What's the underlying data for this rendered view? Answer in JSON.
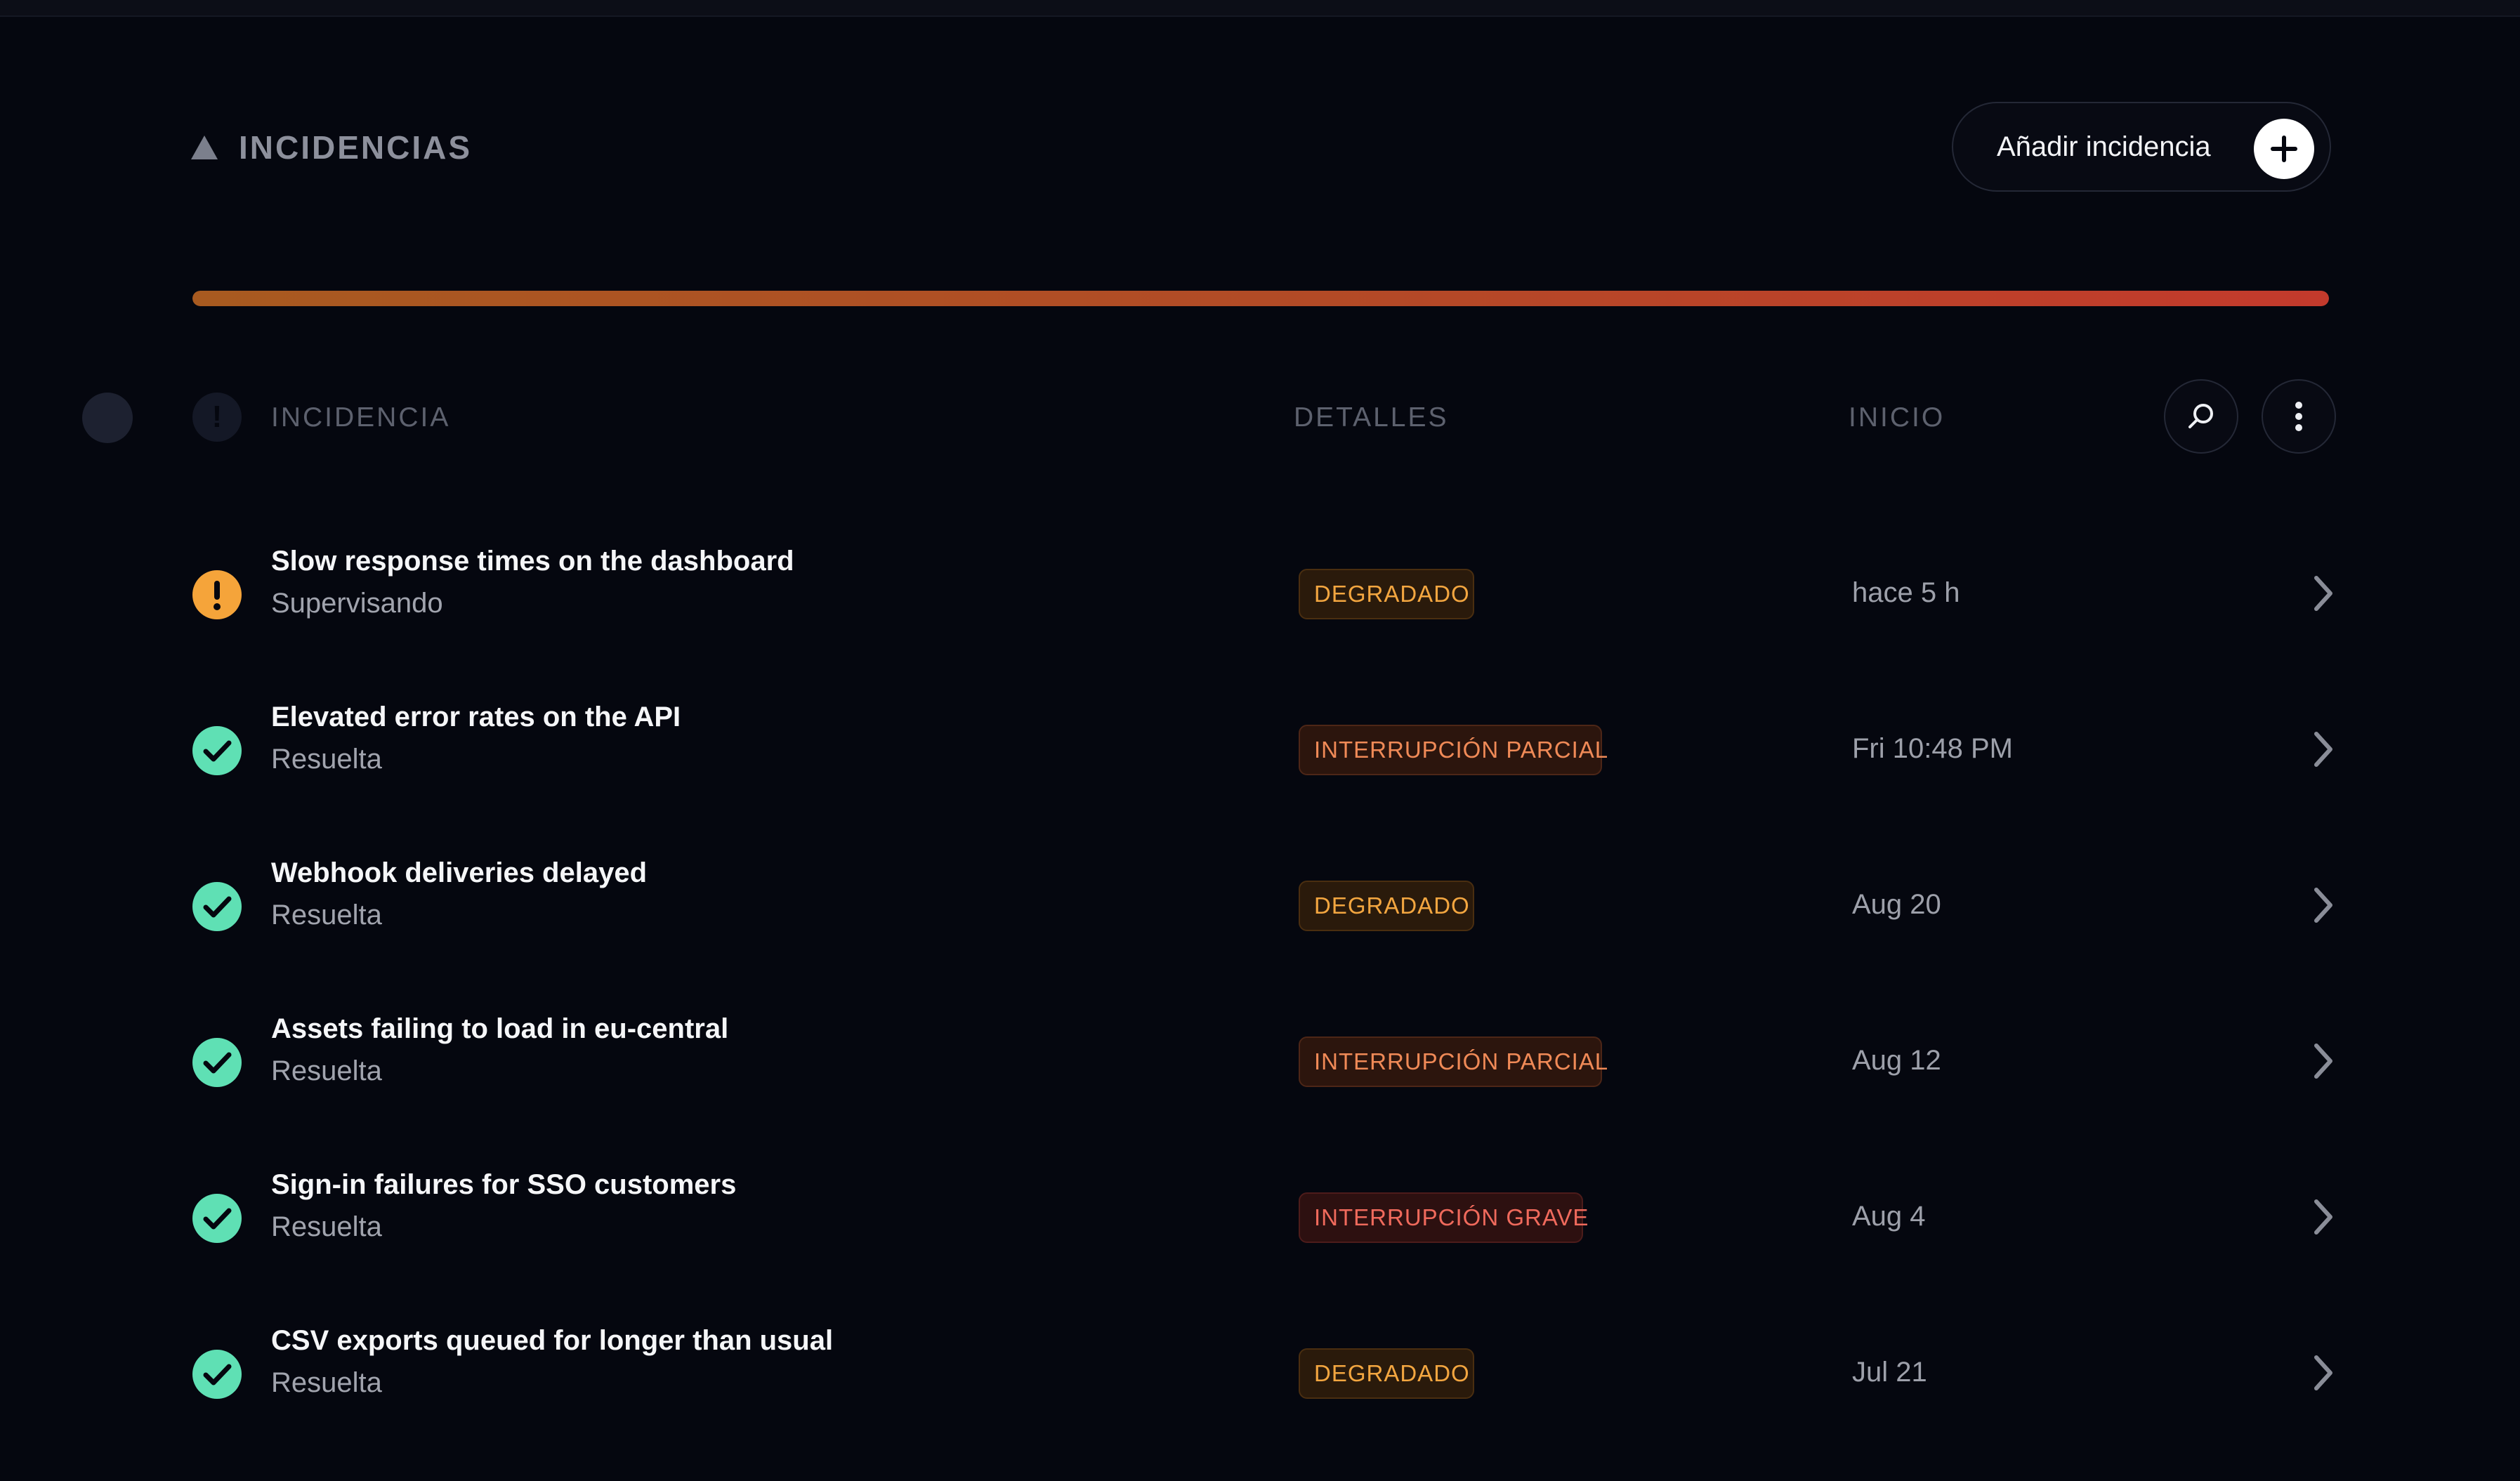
{
  "header": {
    "title": "INCIDENCIAS",
    "add_button_label": "Añadir incidencia"
  },
  "impact_bar": {
    "fill_fraction": 1.0,
    "gradient_colors": [
      "#a85a20",
      "#c33a2c"
    ]
  },
  "table": {
    "columns": {
      "incident": "INCIDENCIA",
      "details": "DETALLES",
      "start": "INICIO"
    },
    "rows": [
      {
        "title": "Slow response times on the dashboard",
        "status": "Supervisando",
        "status_icon": "warning-icon",
        "badge": "DEGRADADO",
        "badge_kind": "degraded",
        "start": "hace 5 h"
      },
      {
        "title": "Elevated error rates on the API",
        "status": "Resuelta",
        "status_icon": "check-icon",
        "badge": "INTERRUPCIÓN PARCIAL",
        "badge_kind": "partial",
        "start": "Fri 10:48 PM"
      },
      {
        "title": "Webhook deliveries delayed",
        "status": "Resuelta",
        "status_icon": "check-icon",
        "badge": "DEGRADADO",
        "badge_kind": "degraded",
        "start": "Aug 20"
      },
      {
        "title": "Assets failing to load in eu-central",
        "status": "Resuelta",
        "status_icon": "check-icon",
        "badge": "INTERRUPCIÓN PARCIAL",
        "badge_kind": "partial",
        "start": "Aug 12"
      },
      {
        "title": "Sign-in failures for SSO customers",
        "status": "Resuelta",
        "status_icon": "check-icon",
        "badge": "INTERRUPCIÓN GRAVE",
        "badge_kind": "major",
        "start": "Aug 4"
      },
      {
        "title": "CSV exports queued for longer than usual",
        "status": "Resuelta",
        "status_icon": "check-icon",
        "badge": "DEGRADADO",
        "badge_kind": "degraded",
        "start": "Jul 21"
      }
    ]
  },
  "colors": {
    "background": "#05070f",
    "warning": "#f5a43a",
    "resolved": "#5fe0b4",
    "degraded_text": "#f3a640",
    "degraded_bg": "#2a1a0b",
    "degraded_border": "#4a2e10",
    "partial_text": "#f08a57",
    "partial_bg": "#2c150d",
    "partial_border": "#4d2617",
    "major_text": "#f06a5c",
    "major_bg": "#2d1010",
    "major_border": "#4d1c1b"
  }
}
